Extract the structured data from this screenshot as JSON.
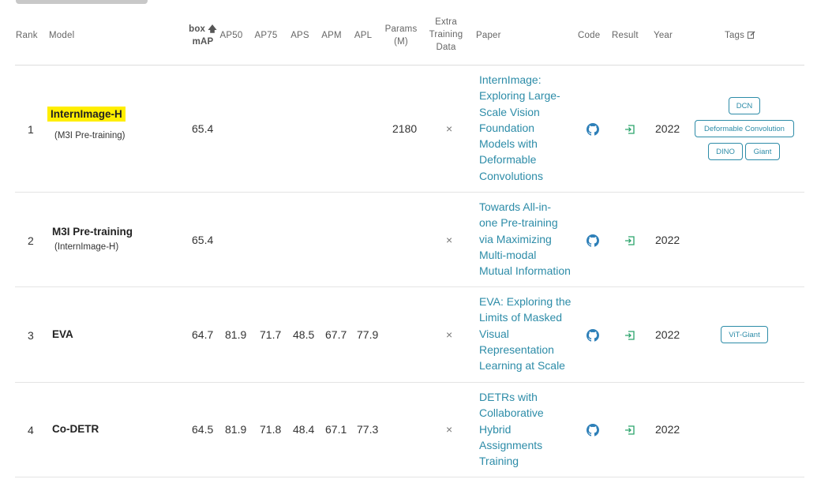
{
  "header": {
    "rank": "Rank",
    "model": "Model",
    "box_map_line1": "box",
    "box_map_line2": "mAP",
    "ap50": "AP50",
    "ap75": "AP75",
    "aps": "APS",
    "apm": "APM",
    "apl": "APL",
    "params_line1": "Params",
    "params_line2": "(M)",
    "extra_line1": "Extra",
    "extra_line2": "Training",
    "extra_line3": "Data",
    "paper": "Paper",
    "code": "Code",
    "result": "Result",
    "year": "Year",
    "tags": "Tags"
  },
  "rows": [
    {
      "rank": "1",
      "model": "InternImage-H",
      "model_sub": "(M3I Pre-training)",
      "box_map": "65.4",
      "ap50": "",
      "ap75": "",
      "aps": "",
      "apm": "",
      "apl": "",
      "params": "2180",
      "extra": "×",
      "paper": [
        "InternImage:",
        "Exploring Large-",
        "Scale Vision",
        "Foundation",
        "Models with",
        "Deformable",
        "Convolutions"
      ],
      "year": "2022",
      "tags": [
        "DCN",
        "Deformable Convolution",
        "DINO",
        "Giant"
      ]
    },
    {
      "rank": "2",
      "model": "M3I Pre-training",
      "model_sub": "(InternImage-H)",
      "box_map": "65.4",
      "ap50": "",
      "ap75": "",
      "aps": "",
      "apm": "",
      "apl": "",
      "params": "",
      "extra": "×",
      "paper": [
        "Towards All-in-",
        "one Pre-training",
        "via Maximizing",
        "Multi-modal",
        "Mutual Information"
      ],
      "year": "2022",
      "tags": []
    },
    {
      "rank": "3",
      "model": "EVA",
      "model_sub": "",
      "box_map": "64.7",
      "ap50": "81.9",
      "ap75": "71.7",
      "aps": "48.5",
      "apm": "67.7",
      "apl": "77.9",
      "params": "",
      "extra": "×",
      "paper": [
        "EVA: Exploring the",
        "Limits of Masked",
        "Visual",
        "Representation",
        "Learning at Scale"
      ],
      "year": "2022",
      "tags": [
        "ViT-Giant"
      ]
    },
    {
      "rank": "4",
      "model": "Co-DETR",
      "model_sub": "",
      "box_map": "64.5",
      "ap50": "81.9",
      "ap75": "71.8",
      "aps": "48.4",
      "apm": "67.1",
      "apl": "77.3",
      "params": "",
      "extra": "×",
      "paper": [
        "DETRs with",
        "Collaborative",
        "Hybrid",
        "Assignments",
        "Training"
      ],
      "year": "2022",
      "tags": []
    }
  ],
  "colors": {
    "link": "#2d8ca8",
    "highlight": "#ffee00",
    "result_icon": "#2aa36b"
  }
}
